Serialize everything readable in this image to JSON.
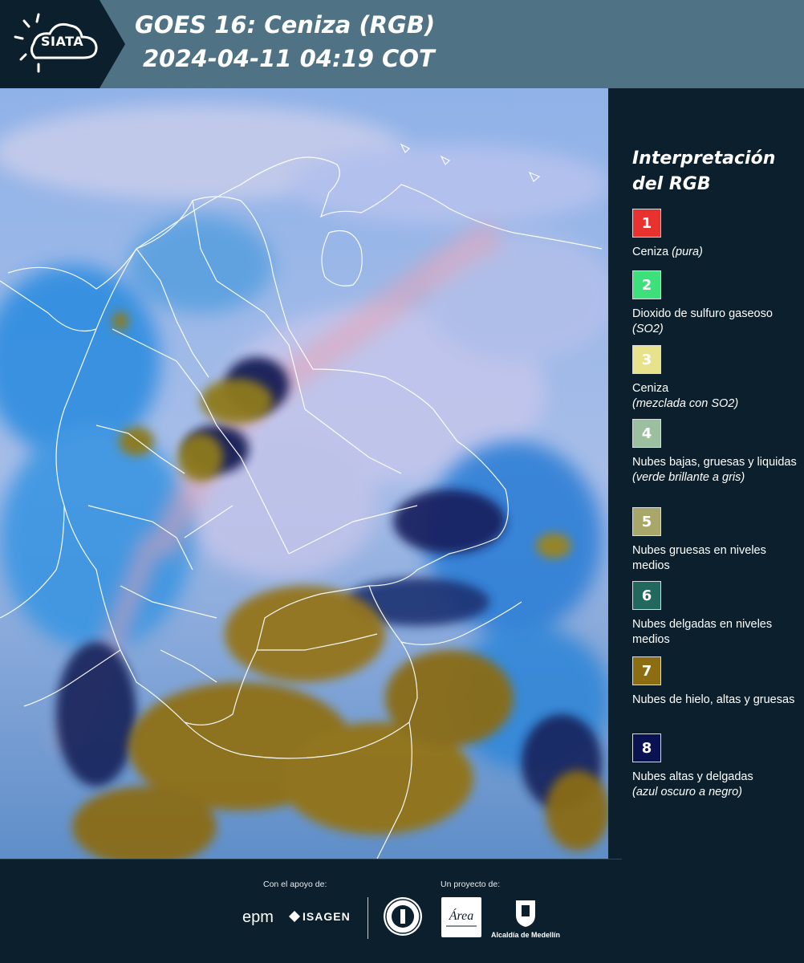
{
  "header": {
    "logo_text": "SIATA",
    "title_line_1": "GOES 16: Ceniza (RGB)",
    "title_line_2": "2024-04-11 04:19 COT"
  },
  "legend": {
    "title_line_1": "Interpretación",
    "title_line_2": "del RGB",
    "items": [
      {
        "number": "1",
        "color": "#e8322f",
        "label": "Ceniza ",
        "label_italic": "(pura)"
      },
      {
        "number": "2",
        "color": "#3de07b",
        "label": "Dioxido de sulfuro gaseoso ",
        "label_italic": "(SO2)"
      },
      {
        "number": "3",
        "color": "#e8e28d",
        "label": "Ceniza",
        "label_italic": "(mezclada con SO2)"
      },
      {
        "number": "4",
        "color": "#9cbfa0",
        "label": "Nubes bajas, gruesas y liquidas",
        "label_italic": "(verde brillante a gris)"
      },
      {
        "number": "5",
        "color": "#a9a66a",
        "label": "Nubes gruesas en niveles medios",
        "label_italic": ""
      },
      {
        "number": "6",
        "color": "#23685e",
        "label": "Nubes delgadas en niveles medios",
        "label_italic": ""
      },
      {
        "number": "7",
        "color": "#8c6d12",
        "label": "Nubes de hielo, altas y gruesas",
        "label_italic": ""
      },
      {
        "number": "8",
        "color": "#0b1252",
        "label": "Nubes altas y delgadas",
        "label_italic": "(azul oscuro a negro)"
      }
    ]
  },
  "footer": {
    "support_label": "Con el apoyo de:",
    "project_label": "Un proyecto de:",
    "epm_logo": "epm",
    "isagen_logo": "ISAGEN",
    "area_logo_text": "Área",
    "alcaldia_text": "Alcaldía de Medellín"
  }
}
